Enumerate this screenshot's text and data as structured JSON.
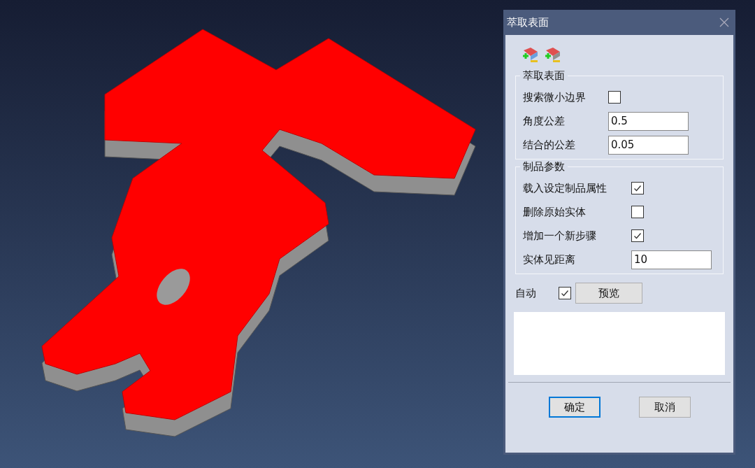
{
  "dialog": {
    "title": "萃取表面",
    "groups": [
      {
        "title": "萃取表面",
        "rows": [
          {
            "kind": "checkbox",
            "label": "搜索微小边界",
            "checked": false
          },
          {
            "kind": "input",
            "label": "角度公差",
            "value": "0.5"
          },
          {
            "kind": "input",
            "label": "结合的公差",
            "value": "0.05"
          }
        ]
      },
      {
        "title": "制品参数",
        "rows": [
          {
            "kind": "checkbox",
            "label": "载入设定制品属性",
            "checked": true
          },
          {
            "kind": "checkbox",
            "label": "删除原始实体",
            "checked": false
          },
          {
            "kind": "checkbox",
            "label": "增加一个新步骤",
            "checked": true
          },
          {
            "kind": "input",
            "label": "实体见距离",
            "value": "10"
          }
        ]
      }
    ],
    "auto": {
      "label": "自动",
      "checked": true
    },
    "preview_button": "预览",
    "buttons": [
      {
        "label": "确定",
        "focused": true
      },
      {
        "label": "取消",
        "focused": false
      }
    ]
  }
}
